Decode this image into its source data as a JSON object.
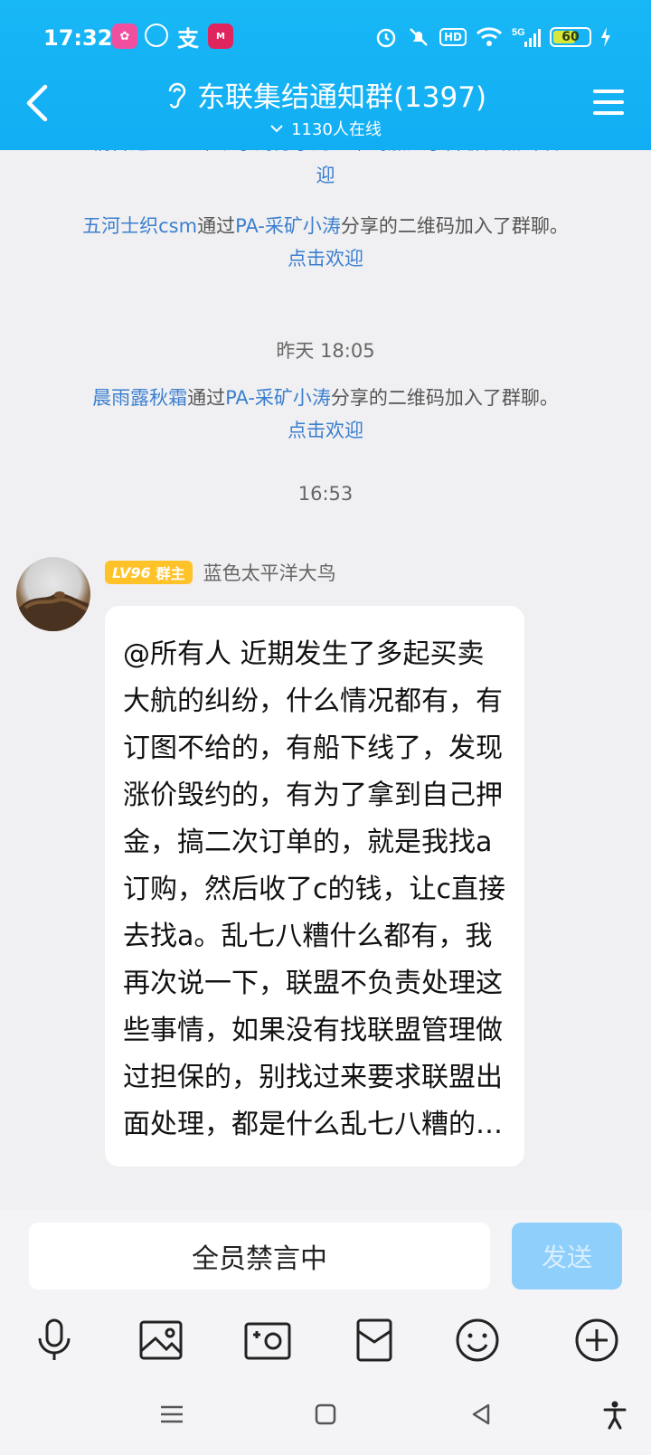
{
  "status_bar": {
    "time": "17:32",
    "battery": "60",
    "network": "5G",
    "hd": "HD"
  },
  "header": {
    "title": "东联集结通知群(1397)",
    "online": "1130人在线"
  },
  "chat": {
    "partial_top_line1": "情群通过PA-采矿小涛分享的二维码加入了群聊。点击欢",
    "partial_top_line2": "迎",
    "join1": {
      "name": "五河士织csm",
      "mid": "通过",
      "via": "PA-采矿小涛",
      "tail": "分享的二维码加入了群聊。",
      "action": "点击欢迎"
    },
    "time1": "昨天 18:05",
    "join2": {
      "name": "晨雨露秋霜",
      "mid": "通过",
      "via": "PA-采矿小涛",
      "tail": "分享的二维码加入了群聊。",
      "action": "点击欢迎"
    },
    "time2": "16:53",
    "message": {
      "level": "LV96",
      "role": "群主",
      "sender": "蓝色太平洋大鸟",
      "text": "@所有人 近期发生了多起买卖大航的纠纷，什么情况都有，有订图不给的，有船下线了，发现涨价毁约的，有为了拿到自己押金，搞二次订单的，就是我找a订购，然后收了c的钱，让c直接去找a。乱七八糟什么都有，我再次说一下，联盟不负责处理这些事情，如果没有找联盟管理做过担保的，别找过来要求联盟出面处理，都是什么乱七八糟的…"
    }
  },
  "input": {
    "muted_text": "全员禁言中",
    "send_label": "发送"
  },
  "colors": {
    "header": "#12aef4",
    "link": "#3c7fcf",
    "badge": "#ffc229",
    "send_disabled": "#8fcffb"
  }
}
